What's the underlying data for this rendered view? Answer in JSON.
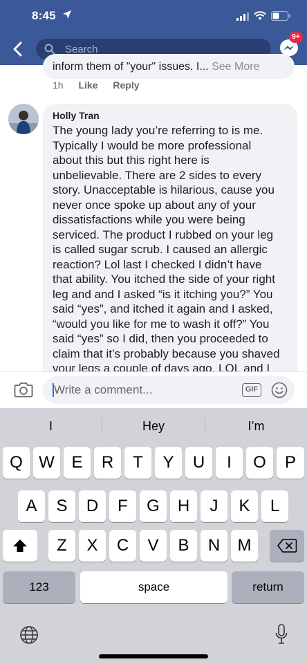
{
  "status": {
    "time": "8:45"
  },
  "nav": {
    "search_placeholder": "Search",
    "messenger_badge": "9+"
  },
  "previous_comment": {
    "text_visible": "inform them of \"your\" issues. I...",
    "see_more": "See More",
    "time": "1h",
    "like": "Like",
    "reply": "Reply"
  },
  "comment": {
    "author": "Holly Tran",
    "lines": [
      "The young lady you’re referring to is me.",
      "Typically I would be more professional",
      "about this but this right here is",
      "unbelievable. There are 2 sides to every",
      "story. Unacceptable is hilarious, cause you",
      "never once spoke up about any of your",
      "dissatisfactions while you were being",
      "serviced. The product I rubbed on your leg",
      "is called sugar scrub. I caused an allergic",
      "reaction? Lol last I checked I didn’t have",
      "that ability. You itched the side of your right",
      "leg and and I asked “is it itching you?” You",
      "said “yes”, and itched it again and I asked,",
      "“would you like for me to wash it off?” You",
      "said “yes” so I did, then you proceeded to",
      "claim that it’s probably because you shaved",
      "your legs a couple of days ago. LOL and I"
    ]
  },
  "composer": {
    "placeholder": "Write a comment...",
    "gif_label": "GIF"
  },
  "keyboard": {
    "suggestions": [
      "I",
      "Hey",
      "I’m"
    ],
    "row1": [
      "Q",
      "W",
      "E",
      "R",
      "T",
      "Y",
      "U",
      "I",
      "O",
      "P"
    ],
    "row2": [
      "A",
      "S",
      "D",
      "F",
      "G",
      "H",
      "J",
      "K",
      "L"
    ],
    "row3": [
      "Z",
      "X",
      "C",
      "V",
      "B",
      "N",
      "M"
    ],
    "numbers_label": "123",
    "space_label": "space",
    "return_label": "return"
  },
  "colors": {
    "facebook_blue": "#3b5998",
    "accent": "#1877f2",
    "badge": "#f02849"
  }
}
